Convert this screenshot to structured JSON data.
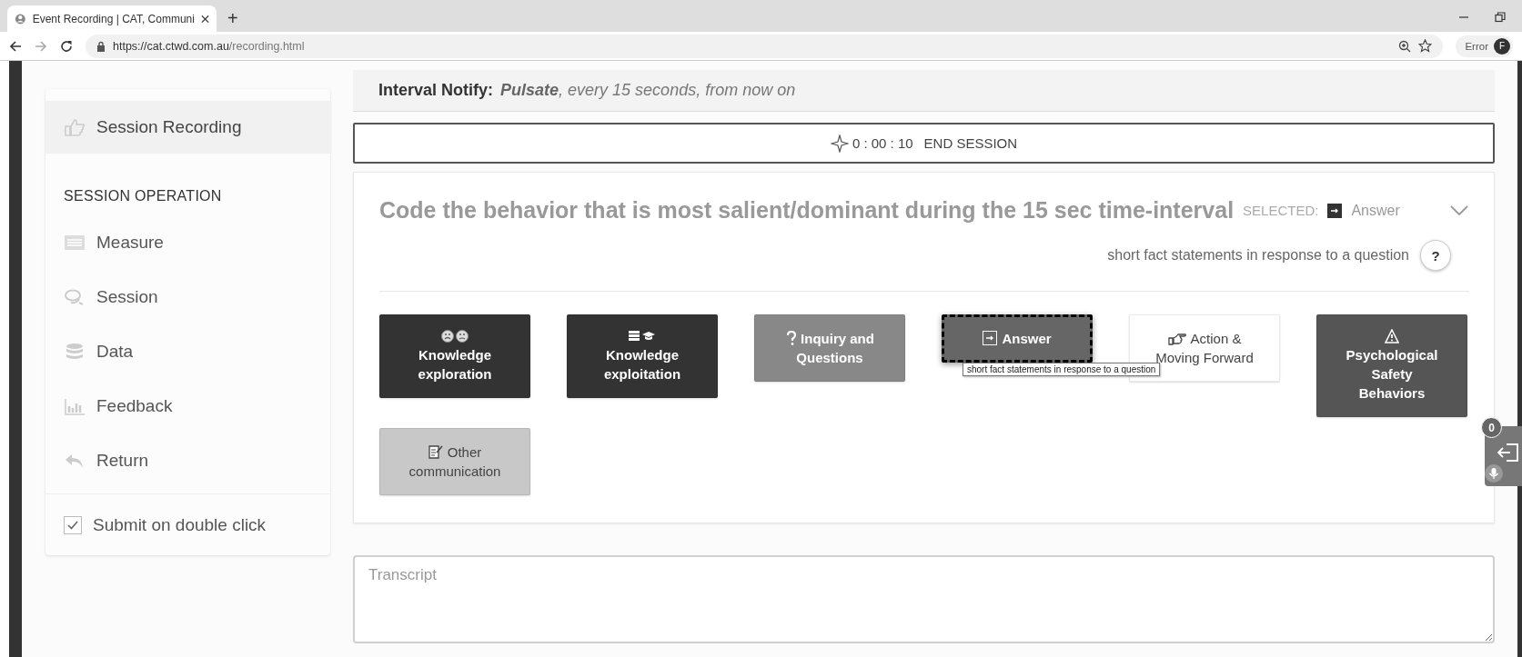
{
  "browser": {
    "tab_title": "Event Recording | CAT, Communi",
    "new_tab": "+",
    "url_host": "https://cat.ctwd.com.au",
    "url_path": "/recording.html",
    "profile": "Error",
    "avatar": "F"
  },
  "sidebar": {
    "top_item": {
      "label": "Session Recording",
      "selected": true
    },
    "section_title": "SESSION OPERATION",
    "items": [
      {
        "label": "Measure",
        "selected": false
      },
      {
        "label": "Session",
        "selected": false
      },
      {
        "label": "Data",
        "selected": false
      },
      {
        "label": "Feedback",
        "selected": false
      },
      {
        "label": "Return",
        "selected": false
      }
    ],
    "submit": {
      "label": "Submit on double click",
      "checked": true
    }
  },
  "interval_notify": {
    "label": "Interval Notify:",
    "text": "**Pulsate**, every 15 seconds, from now on"
  },
  "session_button": {
    "timer": "0 : 00 : 10",
    "label": "END SESSION"
  },
  "coding": {
    "title": "Code the behavior that is most salient/dominant during the 15 sec time-interval",
    "selected_label": "SELECTED:",
    "selected_value": "Answer",
    "description": "short fact statements in response to a question",
    "help": "?",
    "behaviors": [
      {
        "label": "Knowledge exploration",
        "color": "#333333",
        "selected": false
      },
      {
        "label": "Knowledge exploitation",
        "color": "#333333",
        "selected": false
      },
      {
        "label": "Inquiry and Questions",
        "color": "#888888",
        "selected": false
      },
      {
        "label": "Answer",
        "color": "#666666",
        "selected": true
      },
      {
        "label": "Action & Moving Forward",
        "color": "#ffffff",
        "selected": false
      },
      {
        "label": "Psychological Safety Behaviors",
        "color": "#555555",
        "selected": false
      },
      {
        "label": "Other communication",
        "color": "#c8c8c8",
        "selected": false
      }
    ],
    "tooltip": "short fact statements in response to a question"
  },
  "transcript": {
    "placeholder": "Transcript"
  },
  "widget": {
    "badge": "0"
  }
}
